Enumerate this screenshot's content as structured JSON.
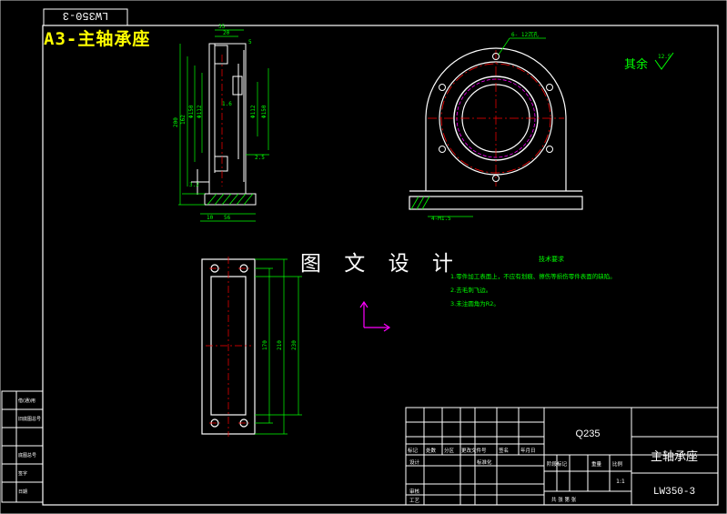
{
  "drawing": {
    "top_tag": "LW350-3",
    "sheet_label": "A3-主轴承座",
    "watermark": "图 文 设 计",
    "rest_roughness": "其余",
    "roughness_value": "12.5",
    "hole_note": "6- 12沉孔",
    "tech_title": "技术要求",
    "tech_req": [
      "1.零件加工表面上，不应有划痕、擦伤等损伤零件表面的缺陷。",
      "2.去毛刺飞边。",
      "3.未注圆角为R2。"
    ],
    "chamfer_note": "4-M1.5",
    "dims_side": [
      "35",
      "20",
      "5",
      "200",
      "162",
      "Φ112",
      "Φ150",
      "1.6",
      "10",
      "56",
      "2.5",
      "3.2"
    ],
    "dims_top": [
      "170",
      "210",
      "230"
    ]
  },
  "title_block": {
    "material": "Q235",
    "part_name": "主轴承座",
    "drawing_number": "LW350-3",
    "scale": "1:1",
    "row_labels": [
      "标记",
      "处数",
      "分区",
      "更改文件号",
      "签名",
      "年月日"
    ],
    "design": "设计",
    "standard": "标准化",
    "process": "工艺",
    "review": "审核",
    "stage_labels": [
      "阶段标记",
      "重量",
      "比例"
    ],
    "sheet": "共 张 第 张"
  },
  "left_strip": [
    "借(通)用",
    "旧底图总号",
    "底图总号",
    "签字",
    "日期"
  ]
}
